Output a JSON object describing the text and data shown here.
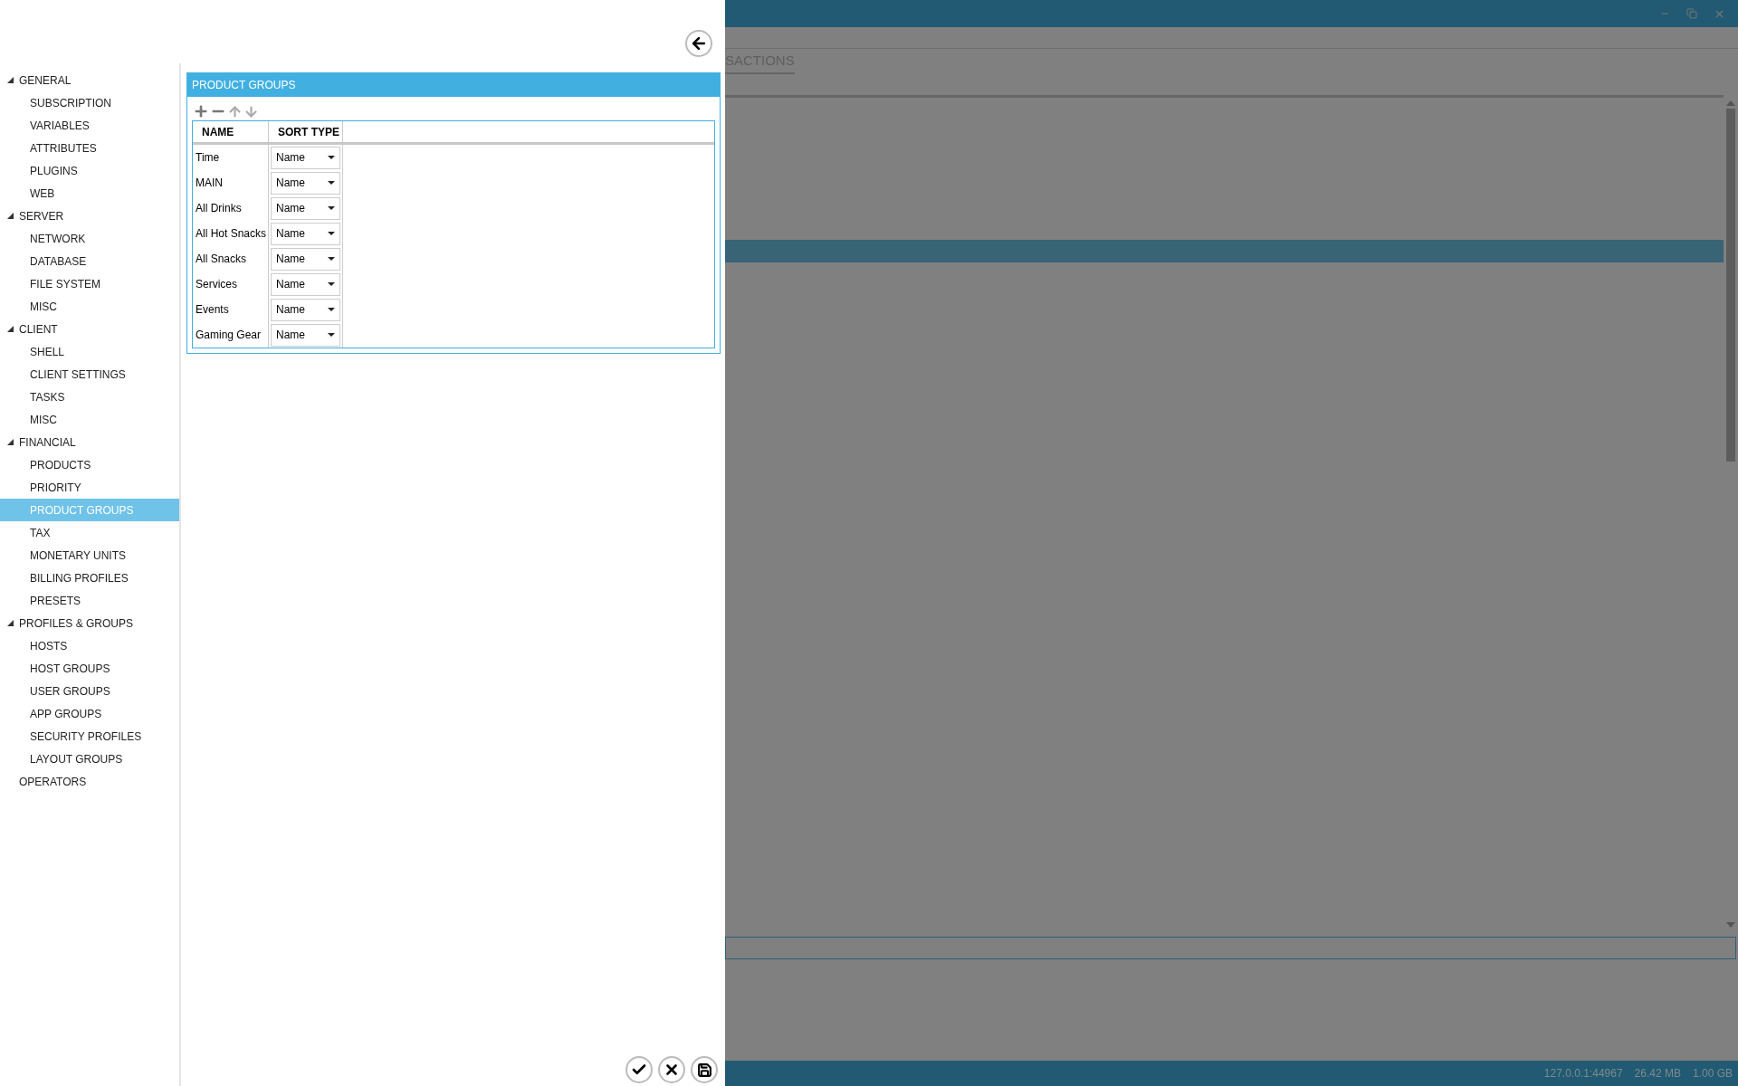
{
  "background_window": {
    "tab": "SACTIONS",
    "status_bar": [
      "127.0.0.1:44967",
      "26.42 MB",
      "1.00 GB"
    ]
  },
  "sidebar": {
    "items": [
      {
        "label": "GENERAL",
        "expanded": true,
        "selected": false,
        "children": [
          {
            "label": "SUBSCRIPTION",
            "selected": false
          },
          {
            "label": "VARIABLES",
            "selected": false
          },
          {
            "label": "ATTRIBUTES",
            "selected": false
          },
          {
            "label": "PLUGINS",
            "selected": false
          },
          {
            "label": "WEB",
            "selected": false
          }
        ]
      },
      {
        "label": "SERVER",
        "expanded": true,
        "selected": false,
        "children": [
          {
            "label": "NETWORK",
            "selected": false
          },
          {
            "label": "DATABASE",
            "selected": false
          },
          {
            "label": "FILE SYSTEM",
            "selected": false
          },
          {
            "label": "MISC",
            "selected": false
          }
        ]
      },
      {
        "label": "CLIENT",
        "expanded": true,
        "selected": false,
        "children": [
          {
            "label": "SHELL",
            "selected": false
          },
          {
            "label": "CLIENT SETTINGS",
            "selected": false
          },
          {
            "label": "TASKS",
            "selected": false
          },
          {
            "label": "MISC",
            "selected": false
          }
        ]
      },
      {
        "label": "FINANCIAL",
        "expanded": true,
        "selected": false,
        "children": [
          {
            "label": "PRODUCTS",
            "selected": false
          },
          {
            "label": "PRIORITY",
            "selected": false
          },
          {
            "label": "PRODUCT GROUPS",
            "selected": true
          },
          {
            "label": "TAX",
            "selected": false
          },
          {
            "label": "MONETARY UNITS",
            "selected": false
          },
          {
            "label": "BILLING PROFILES",
            "selected": false
          },
          {
            "label": "PRESETS",
            "selected": false
          }
        ]
      },
      {
        "label": "PROFILES & GROUPS",
        "expanded": true,
        "selected": false,
        "children": [
          {
            "label": "HOSTS",
            "selected": false
          },
          {
            "label": "HOST GROUPS",
            "selected": false
          },
          {
            "label": "USER GROUPS",
            "selected": false
          },
          {
            "label": "APP GROUPS",
            "selected": false
          },
          {
            "label": "SECURITY PROFILES",
            "selected": false
          },
          {
            "label": "LAYOUT GROUPS",
            "selected": false
          }
        ]
      },
      {
        "label": "OPERATORS",
        "selected": false
      }
    ]
  },
  "panel": {
    "title": "PRODUCT GROUPS",
    "table": {
      "columns": [
        "NAME",
        "SORT TYPE"
      ],
      "rows": [
        {
          "name": "Time",
          "sort_type": "Name"
        },
        {
          "name": "MAIN",
          "sort_type": "Name"
        },
        {
          "name": "All Drinks",
          "sort_type": "Name"
        },
        {
          "name": "All Hot Snacks",
          "sort_type": "Name"
        },
        {
          "name": "All Snacks",
          "sort_type": "Name"
        },
        {
          "name": "Services",
          "sort_type": "Name"
        },
        {
          "name": "Events",
          "sort_type": "Name"
        },
        {
          "name": "Gaming Gear",
          "sort_type": "Name"
        }
      ]
    }
  }
}
